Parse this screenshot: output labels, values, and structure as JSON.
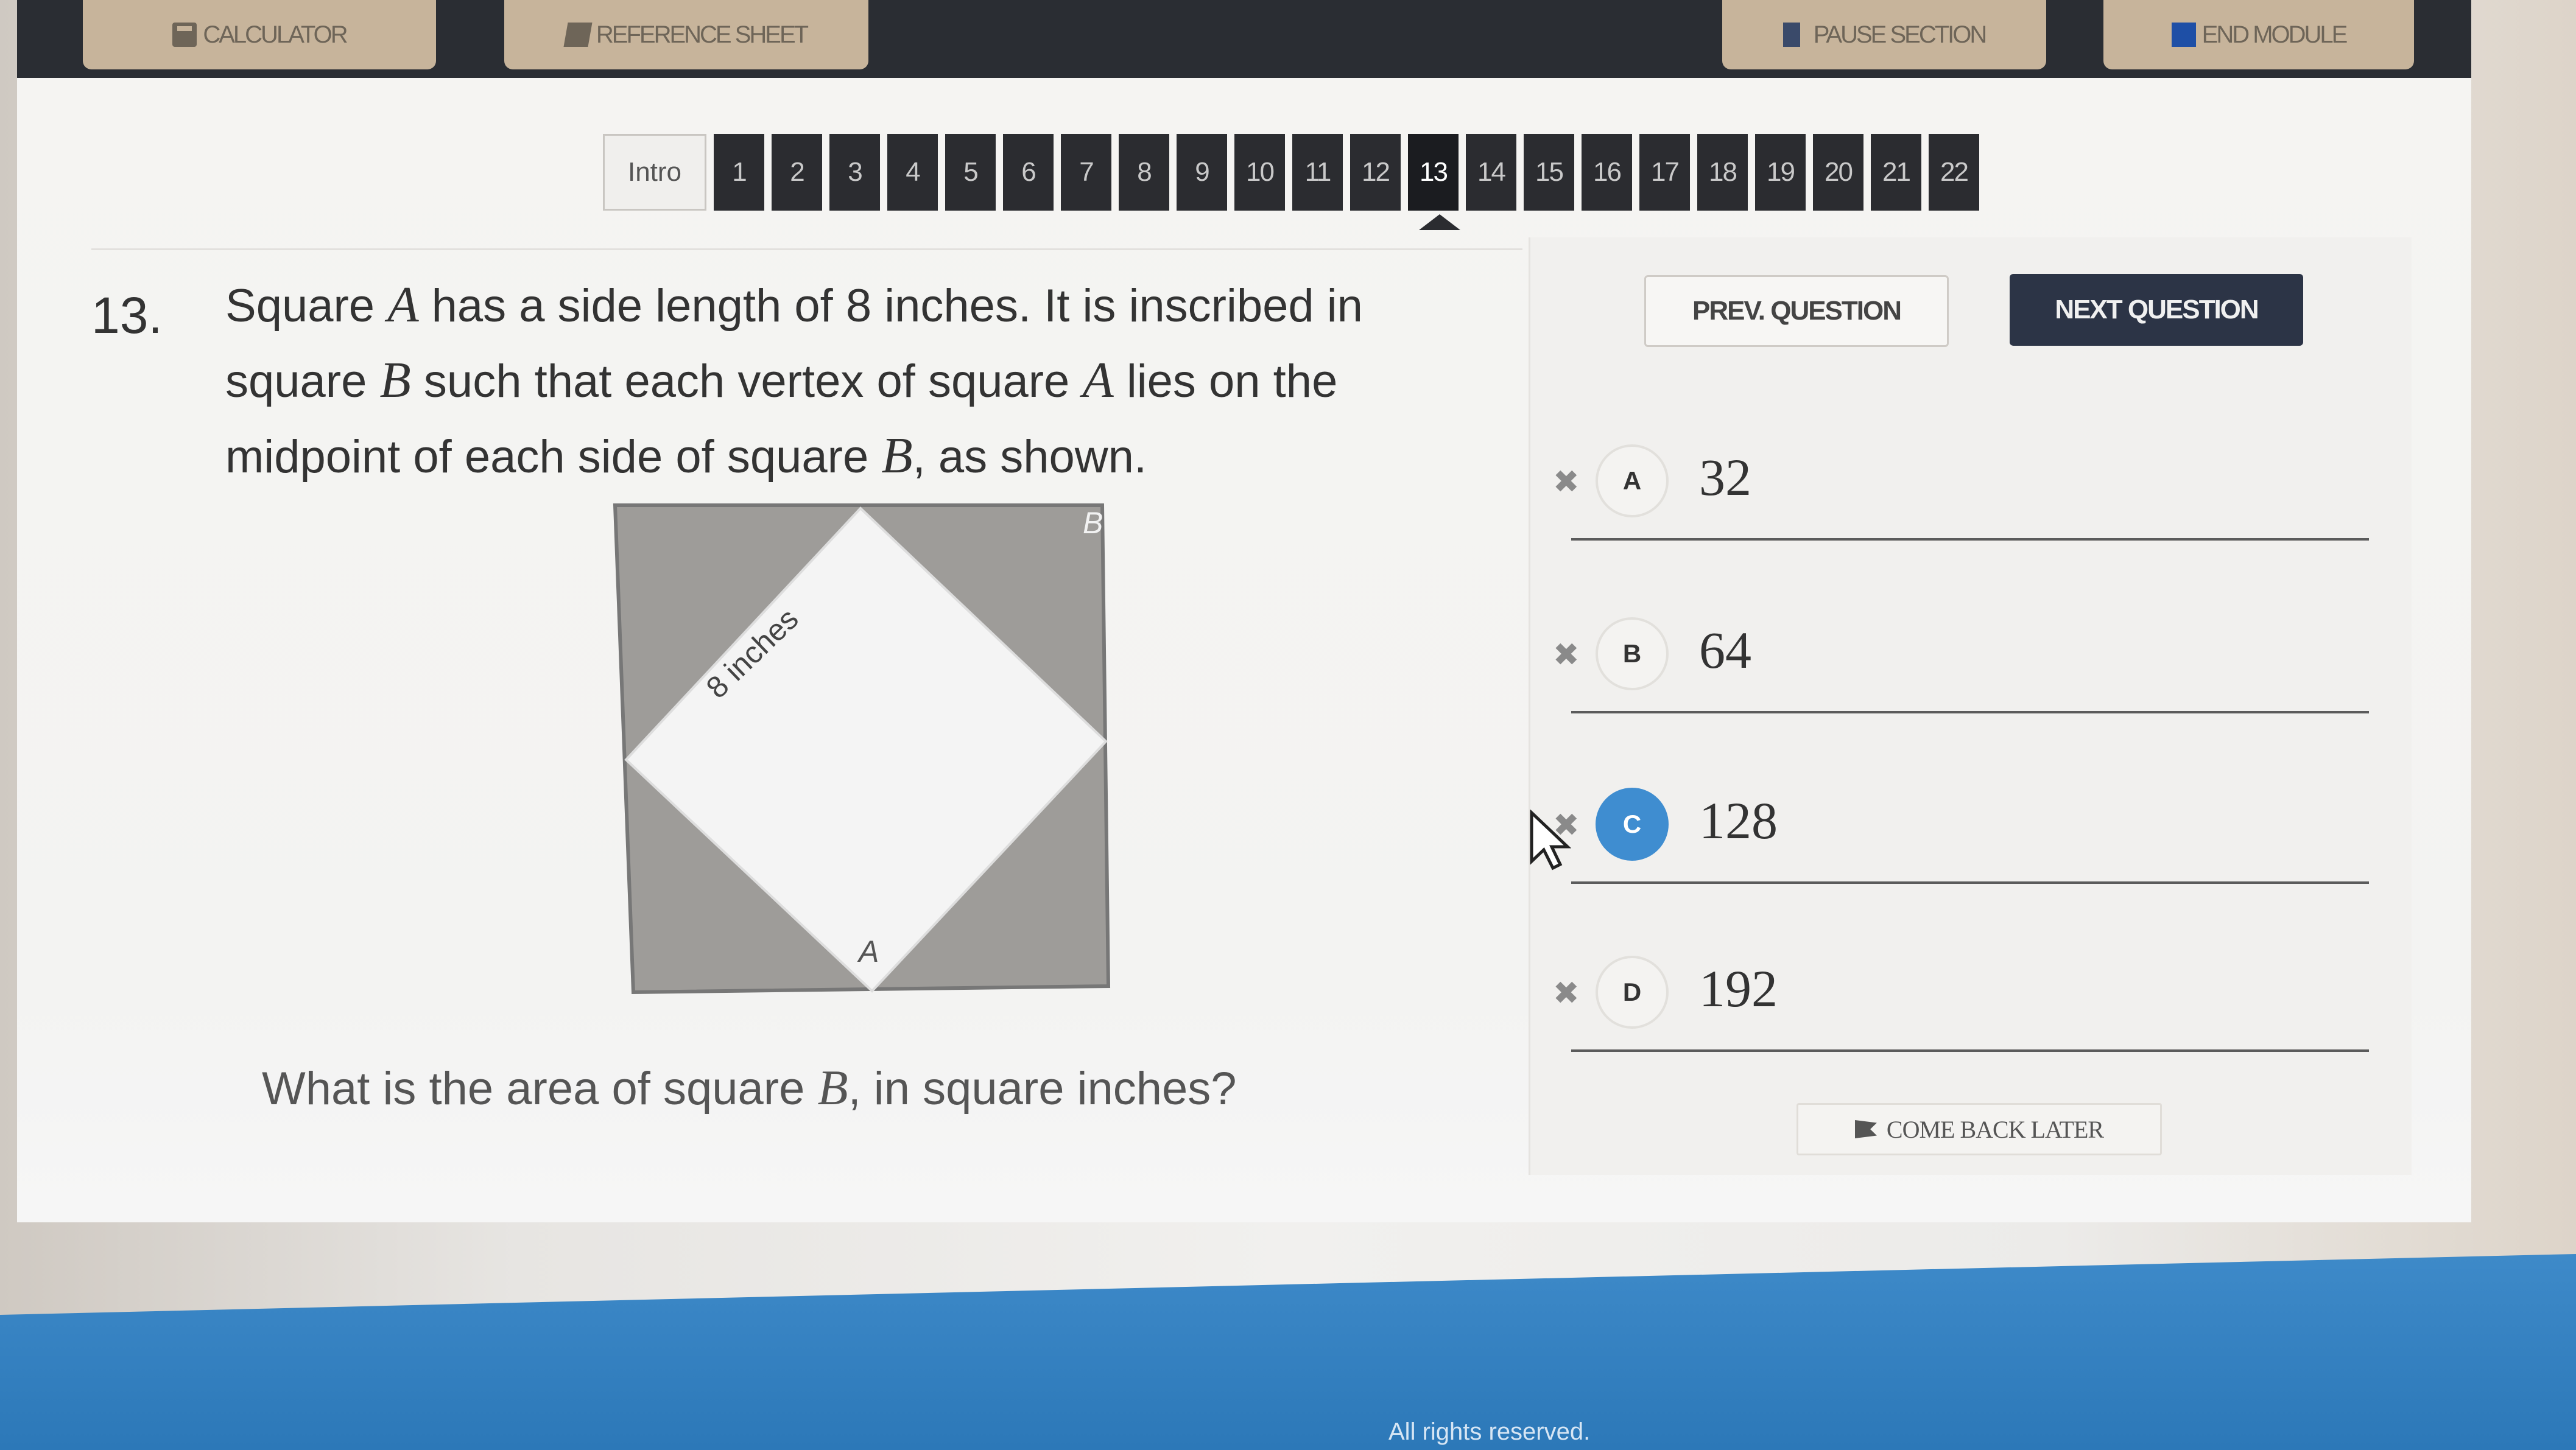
{
  "toolbar": {
    "calculator_label": "CALCULATOR",
    "reference_label": "REFERENCE SHEET",
    "pause_label": "PAUSE SECTION",
    "end_label": "END MODULE"
  },
  "nav": {
    "intro_label": "Intro",
    "questions": [
      "1",
      "2",
      "3",
      "4",
      "5",
      "6",
      "7",
      "8",
      "9",
      "10",
      "11",
      "12",
      "13",
      "14",
      "15",
      "16",
      "17",
      "18",
      "19",
      "20",
      "21",
      "22"
    ],
    "current": "13"
  },
  "question": {
    "number": "13.",
    "text_1": "Square ",
    "var_a": "A",
    "text_2": " has a side length of 8 inches. It is inscribed in square ",
    "var_b": "B",
    "text_3": " such that each vertex of square ",
    "var_a2": "A",
    "text_4": " lies on the midpoint of each side of square ",
    "var_b2": "B",
    "text_5": ", as shown.",
    "prompt_1": "What is the area of square ",
    "prompt_var": "B",
    "prompt_2": ", in square inches?"
  },
  "figure": {
    "label_b": "B",
    "label_a": "A",
    "side_label": "8 inches",
    "outer_fill": "#9e9c99",
    "inner_fill": "#f4f4f4"
  },
  "panel": {
    "prev_label": "PREV. QUESTION",
    "next_label": "NEXT QUESTION",
    "come_back_label": "COME BACK LATER"
  },
  "choices": [
    {
      "letter": "A",
      "value": "32",
      "selected": false
    },
    {
      "letter": "B",
      "value": "64",
      "selected": false
    },
    {
      "letter": "C",
      "value": "128",
      "selected": true
    },
    {
      "letter": "D",
      "value": "192",
      "selected": false
    }
  ],
  "footer": {
    "rights": "All rights reserved."
  },
  "colors": {
    "accent_blue": "#3f8dd0",
    "topbar": "#2a2d33",
    "button_tan": "#c7b49b",
    "next_button": "#2c3446"
  }
}
